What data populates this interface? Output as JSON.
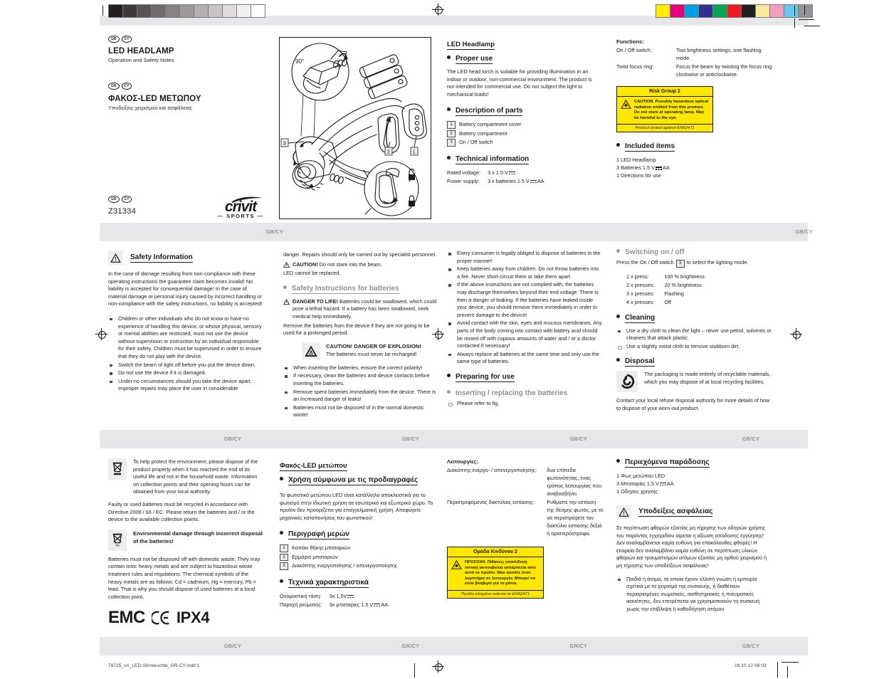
{
  "meta": {
    "file_name": "78725_cri_LED-Stirnleuchte_GR-CY.indd   1",
    "timestamp": "16.10.12   08:03",
    "band_label": "GB/CY",
    "band_label_gr": "GR/CY",
    "article_code": "Z31334"
  },
  "calibration": {
    "gray_steps": [
      "#231f20",
      "#3c3a3b",
      "#565455",
      "#6d6b6c",
      "#848283",
      "#9b999a",
      "#b2b0b1",
      "#c6c4c5",
      "#dddbdc",
      "#f1eff0",
      "#ffffff"
    ],
    "color_steps": [
      "#ffec00",
      "#e5007e",
      "#00a0e3",
      "#2e3192",
      "#00a651",
      "#ed1c24",
      "#231f20",
      "#faea9a",
      "#f39ec1",
      "#65c9ee",
      "#939598"
    ]
  },
  "cover": {
    "badges_en": [
      "GB",
      "CY"
    ],
    "title_en": "LED HEADLAMP",
    "subtitle_en": "Operation and Safety Notes",
    "badges_gr": [
      "GR",
      "CY"
    ],
    "title_gr": "ΦΑΚΟΣ-LED ΜΕΤΩΠΟΥ",
    "subtitle_gr": "Υποδείξεις χειρισμού και ασφάλειας",
    "badges_logo": [
      "GR",
      "CY"
    ],
    "logo_name": "crivit",
    "logo_tag": "— SPORTS —",
    "figure_label_angle": "90°",
    "figure_callouts": [
      "1",
      "2",
      "3"
    ]
  },
  "en": {
    "doc_title": "LED Headlamp",
    "proper_use": {
      "heading": "Proper use",
      "body": "The LED head torch is suitable for providing illumination in an indoor or outdoor, non-commercial environment. The product is not intended for commercial use. Do not subject the light to mechanical loads!"
    },
    "description": {
      "heading": "Description of parts",
      "parts": [
        {
          "num": "1",
          "label": "Battery compartment cover"
        },
        {
          "num": "2",
          "label": "Battery compartment"
        },
        {
          "num": "3",
          "label": "On / Off switch"
        }
      ]
    },
    "technical": {
      "heading": "Technical information",
      "rows": [
        {
          "key": "Rated voltage:",
          "value_pre": "3 x 1.5 V",
          "value_post": ""
        },
        {
          "key": "Power supply:",
          "value_pre": "3 x batteries 1.5 V",
          "value_post": "AA"
        }
      ]
    },
    "functions": {
      "heading": "Functions:",
      "rows": [
        {
          "key": "On / Off switch:",
          "value": "Two brightness settings, one flashing mode."
        },
        {
          "key": "Twist focus ring:",
          "value": "Focus the beam by twisting the focus ring clockwise or anticlockwise."
        }
      ]
    },
    "risk": {
      "title": "Risk Group 2",
      "body": "CAUTION. Possibly hazardous optical radiation emitted from this product. Do not stare at operating lamp. May be harmful to the eye.",
      "footer": "Product tested against EN62471"
    },
    "included": {
      "heading": "Included items",
      "items_pre": [
        "1 LED Headlamp",
        "3 Batteries 1.5 V",
        "1 Directions for use"
      ],
      "battery_line_pre": "3 Batteries 1.5 V",
      "battery_line_post": "AA"
    },
    "safety": {
      "heading": "Safety Information",
      "intro": "In the case of damage resulting from non-compliance with these operating instructions the guarantee claim becomes invalid! No liability is accepted for consequential damage! In the case of material damage or personal injury caused by incorrect handling or non-compliance with the safety instructions, no liability is accepted!",
      "bullets": [
        "Children or other individuals who do not know or have no experience of handling this device, or whose physical, sensory or mental abilities are restricted, must not use the device without supervision or instruction by an individual responsible for their safety. Children must be supervised in order to ensure that they do not play with the device.",
        "Switch the beam of light off before you put the device down.",
        "Do not use the device if it is damaged.",
        "Under no circumstances should you take the device apart. Improper repairs may place the user in considerable"
      ],
      "cont": "danger. Repairs should only be carried out by specialist personnel.",
      "caution_bold": "CAUTION!",
      "caution_rest": " Do not stare into the beam.",
      "caution_line2": "LED cannot be replaced."
    },
    "battery_safety": {
      "heading": "Safety Instructions for batteries",
      "danger_bold": "DANGER TO LIFE!",
      "danger_rest": " Batteries could be swallowed, which could pose a lethal hazard. If a battery has been swallowed, seek medical help immediately.",
      "remove_line": "Remove the batteries from the device if they are not going to be used for a prolonged period.",
      "explosion_title": "CAUTION! DANGER OF EXPLOSION!",
      "explosion_body": "The batteries must never be recharged!",
      "after": [
        "When inserting the batteries, ensure the correct polarity!",
        "If necessary, clean the batteries and device contacts before inserting the batteries.",
        "Remove spent batteries immediately from the device. There is an increased danger of leaks!",
        "Batteries must not be disposed of in the normal domestic waste!"
      ],
      "bullets2": [
        "Every consumer is legally obliged to dispose of batteries in the proper manner!",
        "Keep batteries away from children. Do not throw batteries into a fire. Never short-circuit them or take them apart.",
        "If the above instructions are not complied with, the batteries may discharge themselves beyond their end voltage. There is then a danger of leaking. If the batteries have leaked inside your device, you should remove them immediately in order to prevent damage to the device!",
        "Avoid contact with the skin, eyes and mucous membranes. Any parts of the body coming into contact with battery acid should be rinsed off with copious amounts of water and / or a doctor contacted if necessary!",
        "Always replace all batteries at the same time and only use the same type of batteries."
      ]
    },
    "preparing": {
      "heading": "Preparing for use",
      "sub_heading": "Inserting / replacing the batteries",
      "body": "Please refer to fig."
    },
    "switching": {
      "heading": "Switching on / off",
      "intro_pre": "Press the On / Off switch",
      "intro_num": "3",
      "intro_post": "to select the lighting mode.",
      "modes": [
        {
          "key": "1 x press:",
          "value": "100 % brightness"
        },
        {
          "key": "2 x presses:",
          "value": "20 % brightness"
        },
        {
          "key": "3 x presses:",
          "value": "Flashing"
        },
        {
          "key": "4 x presses:",
          "value": "Off"
        }
      ]
    },
    "cleaning": {
      "heading": "Cleaning",
      "bullets": [
        "Use a dry cloth to clean the light – never use petrol, solvents or cleaners that attack plastic.",
        "Use a slightly moist cloth to remove stubborn dirt."
      ]
    },
    "disposal": {
      "heading": "Disposal",
      "recycle_body": "The packaging is made entirely of recyclable materials, which you may dispose of at local recycling facilities.",
      "contact": "Contact your local refuse disposal authority for more details of how to dispose of your worn-out product.",
      "wee_body": "To help protect the environment, please dispose of the product properly when it has reached the end of its useful life and not in the household waste. Information on collection points and their opening hours can be obtained from your local authority.",
      "directive": "Faulty or used batteries must be recycled in accordance with Directive 2006 / 66 / EC. Please return the batteries and / or the device to the available collection points.",
      "env_damage_title": "Environmental damage through incorrect disposal of the batteries!",
      "env_damage_body": "Batteries must not be disposed off with domestic waste. They may contain toxic heavy metals and are subject to hazardous waste treatment rules and regulations. The chemical symbols of the heavy metals are as follows: Cd = cadmium, Hg = mercury, Pb = lead. That is why you should dispose of used batteries at a local collection point.",
      "pb_label": "Pb"
    },
    "marks": {
      "emc": "EMC",
      "ce": "CE",
      "ipx": "IPX4"
    }
  },
  "gr": {
    "doc_title": "Φακός-LED μετώπου",
    "proper_use": {
      "heading": "Χρήση σύμφωνα με τις προδιαγραφές",
      "body": "Το φωτιστικό μετώπου LED είναι κατάλληλο αποκλειστικά για το φωτισμό στην ιδιωτική χρήση σε εσωτερικό και εξωτερικό χώρο. Το προϊόν δεν προορίζεται για επαγγελματική χρήση. Αποφύγετε μηχανικές καταπονήσεις του φωτιστικού!"
    },
    "description": {
      "heading": "Περιγραφή μερών",
      "parts": [
        {
          "num": "1",
          "label": "Καπάκι θήκης μπαταριών"
        },
        {
          "num": "2",
          "label": "Ερμάριο μπαταριών"
        },
        {
          "num": "3",
          "label": "Διακόπτης ενεργοποίησης / απενεργοποίησης"
        }
      ]
    },
    "technical": {
      "heading": "Τεχνικά χαρακτηριστικά",
      "rows": [
        {
          "key": "Ονομαστική τάση:",
          "value_pre": "3x 1,5V",
          "value_post": ""
        },
        {
          "key": "Παροχή ρεύματος:",
          "value_pre": "3x μπαταρίες 1,5 V",
          "value_post": "AA"
        }
      ]
    },
    "functions": {
      "heading": "Λειτουργίες:",
      "rows": [
        {
          "key": "Διακόπτης ενεργο- / απενεργοποίησης:",
          "value": "δυο επίπεδα φωτεινότητας, ένας τρόπος λειτουργίας που αναβοσβήνει."
        },
        {
          "key": "Περιστρεφόμενος δακτύλιος εστίασης:",
          "value": "Ρυθμίστε την εστίαση της δέσμης φωτός, με το να περιστρέψετε τον δακτύλιο εστίασης δεξιά ή αριστερόστροφα."
        }
      ]
    },
    "risk": {
      "title": "Ομάδα Κινδύνου 2",
      "body": "ΠΡΟΣΟΧΗ. Πιθανώς επικίνδυνη οπτική ακτινοβολία εκπέμπεται από αυτό το προϊόν. Μην κοιτάτε στον λαμπτήρα σε λειτουργία. Μπορεί να είναι βλαβερό για τα μάτια.",
      "footer": "Προϊόν ελεγμένο ενάντια σε EN62471"
    },
    "included": {
      "heading": "Περιεχόμενα παράδοσης",
      "item1": "1 Φως μετώπου LED",
      "battery_line_pre": "3 Μπαταρίες 1,5 V",
      "battery_line_post": "AA",
      "item3": "1 Οδηγίες χρήσης"
    },
    "safety": {
      "heading": "Υποδείξεις ασφάλειας",
      "intro": "Σε περίπτωση φθορών εξαιτίας μη τήρησης των οδηγιών χρήσης του παρόντος εγχειριδίου αίρεται η αξίωση απόδοσης εγγύησης! Δεν αναλαμβάνεται καμία ευθύνη για επακόλουθες φθορές! Η εταιρεία δεν αναλαμβάνει καμία ευθύνη σε περίπτωση υλικών φθορών και τραυματισμών ατόμων εξαιτίας μη ορθού χειρισμού ή μη τήρησης των υποδείξεων ασφάλειας!",
      "bullets": [
        "Παιδιά ή άτομα, τα οποία έχουν ελλιπή γνώση ή εμπειρία σχετικά με το χειρισμό της συσκευής, ή διαθέτουν περιορισμένες σωματικές, αισθητηριακές ή πνευματικές ικανότητες, δεν επιτρέπεται να χρησιμοποιούν τη συσκευή χωρίς την επίβλεψη ή καθοδήγηση ατόμου"
      ]
    }
  }
}
